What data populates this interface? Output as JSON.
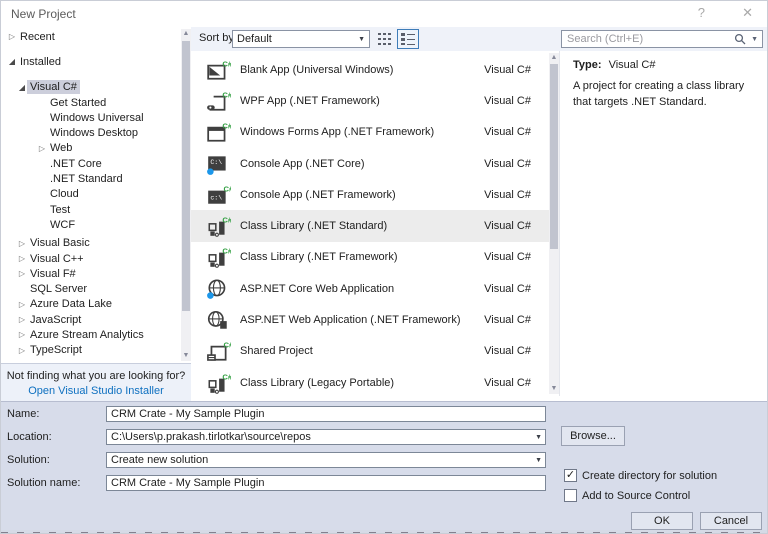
{
  "title_bar": {
    "title": "New Project",
    "help_glyph": "?",
    "close_glyph": "✕"
  },
  "toolbar": {
    "sort_by_label": "Sort by:",
    "sort_value": "Default"
  },
  "search": {
    "placeholder": "Search (Ctrl+E)"
  },
  "tree": {
    "items": [
      {
        "label": "Recent",
        "level": 1,
        "arrow": "collapsed",
        "gap": "none"
      },
      {
        "label": "Installed",
        "level": 1,
        "arrow": "expanded",
        "gap": "lg"
      },
      {
        "label": "Visual C#",
        "level": 2,
        "arrow": "expanded",
        "selected": true,
        "gap": "lg"
      },
      {
        "label": "Get Started",
        "level": 3,
        "arrow": "none"
      },
      {
        "label": "Windows Universal",
        "level": 3,
        "arrow": "none"
      },
      {
        "label": "Windows Desktop",
        "level": 3,
        "arrow": "none"
      },
      {
        "label": "Web",
        "level": 3,
        "arrow": "collapsed"
      },
      {
        "label": ".NET Core",
        "level": 3,
        "arrow": "none"
      },
      {
        "label": ".NET Standard",
        "level": 3,
        "arrow": "none"
      },
      {
        "label": "Cloud",
        "level": 3,
        "arrow": "none"
      },
      {
        "label": "Test",
        "level": 3,
        "arrow": "none"
      },
      {
        "label": "WCF",
        "level": 3,
        "arrow": "none"
      },
      {
        "label": "Visual Basic",
        "level": 2,
        "arrow": "collapsed",
        "gap": "sm"
      },
      {
        "label": "Visual C++",
        "level": 2,
        "arrow": "collapsed"
      },
      {
        "label": "Visual F#",
        "level": 2,
        "arrow": "collapsed"
      },
      {
        "label": "SQL Server",
        "level": 2,
        "arrow": "none"
      },
      {
        "label": "Azure Data Lake",
        "level": 2,
        "arrow": "collapsed"
      },
      {
        "label": "JavaScript",
        "level": 2,
        "arrow": "collapsed"
      },
      {
        "label": "Azure Stream Analytics",
        "level": 2,
        "arrow": "collapsed"
      },
      {
        "label": "TypeScript",
        "level": 2,
        "arrow": "collapsed"
      }
    ],
    "footer": {
      "question": "Not finding what you are looking for?",
      "link": "Open Visual Studio Installer"
    }
  },
  "templates": [
    {
      "name": "Blank App (Universal Windows)",
      "lang": "Visual C#",
      "icon": "blank-app",
      "selected": false
    },
    {
      "name": "WPF App (.NET Framework)",
      "lang": "Visual C#",
      "icon": "wpf-app",
      "selected": false
    },
    {
      "name": "Windows Forms App (.NET Framework)",
      "lang": "Visual C#",
      "icon": "winforms-app",
      "selected": false
    },
    {
      "name": "Console App (.NET Core)",
      "lang": "Visual C#",
      "icon": "console-core",
      "selected": false
    },
    {
      "name": "Console App (.NET Framework)",
      "lang": "Visual C#",
      "icon": "console-fw",
      "selected": false
    },
    {
      "name": "Class Library (.NET Standard)",
      "lang": "Visual C#",
      "icon": "class-library",
      "selected": true
    },
    {
      "name": "Class Library (.NET Framework)",
      "lang": "Visual C#",
      "icon": "class-library",
      "selected": false
    },
    {
      "name": "ASP.NET Core Web Application",
      "lang": "Visual C#",
      "icon": "aspnet-core",
      "selected": false
    },
    {
      "name": "ASP.NET Web Application (.NET Framework)",
      "lang": "Visual C#",
      "icon": "aspnet-fw",
      "selected": false
    },
    {
      "name": "Shared Project",
      "lang": "Visual C#",
      "icon": "shared-project",
      "selected": false
    },
    {
      "name": "Class Library (Legacy Portable)",
      "lang": "Visual C#",
      "icon": "class-library-legacy",
      "selected": false
    }
  ],
  "description": {
    "type_label": "Type:",
    "type_value": "Visual C#",
    "text": "A project for creating a class library that targets .NET Standard."
  },
  "form": {
    "name_label": "Name:",
    "name_value": "CRM Crate - My Sample Plugin",
    "location_label": "Location:",
    "location_value": "C:\\Users\\p.prakash.tirlotkar\\source\\repos",
    "browse_label": "Browse...",
    "solution_label": "Solution:",
    "solution_value": "Create new solution",
    "solution_name_label": "Solution name:",
    "solution_name_value": "CRM Crate - My Sample Plugin",
    "checkbox_create_dir": {
      "label": "Create directory for solution",
      "checked": true
    },
    "checkbox_source_control": {
      "label": "Add to Source Control",
      "checked": false
    },
    "ok_label": "OK",
    "cancel_label": "Cancel"
  },
  "colors": {
    "link_blue": "#0e70c0",
    "csharp_green": "#2f9e3f",
    "dotnet_core_blue": "#1c97ea",
    "tree_selection_bg": "#cccedb",
    "list_selection_bg": "#ececec",
    "form_bg": "#d7dcea",
    "header_bg": "#eff2f9"
  }
}
